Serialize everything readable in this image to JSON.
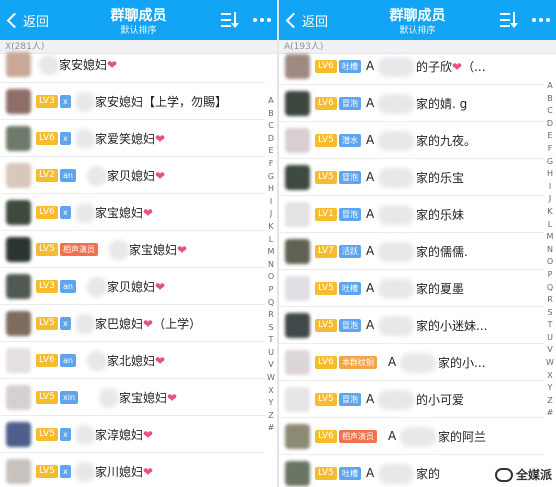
{
  "left": {
    "nav": {
      "back": "返回",
      "title": "群聊成员",
      "subtitle": "默认排序"
    },
    "section": "X(281人)",
    "rows": [
      {
        "lv": "",
        "tag": "",
        "tag_color": "blue",
        "pre": "",
        "name": "家安媳妇",
        "heart": "❤",
        "suffix": "",
        "avatar": "#c9a996"
      },
      {
        "lv": "LV3",
        "tag": "x",
        "tag_color": "blue",
        "pre": "",
        "name": "家安媳妇【上学，勿賜】",
        "heart": "",
        "suffix": "",
        "avatar": "#8d6f68"
      },
      {
        "lv": "LV6",
        "tag": "x",
        "tag_color": "blue",
        "pre": "",
        "name": "家爱笑媳妇",
        "heart": "❤",
        "suffix": "",
        "avatar": "#6f7a6b"
      },
      {
        "lv": "LV2",
        "tag": "an",
        "tag_color": "blue",
        "pre": "",
        "name": "家贝媳妇",
        "heart": "❤",
        "suffix": "",
        "avatar": "#d8c7bd"
      },
      {
        "lv": "LV6",
        "tag": "x",
        "tag_color": "blue",
        "pre": "",
        "name": "家宝媳妇",
        "heart": "❤",
        "suffix": "",
        "avatar": "#3f4a3e"
      },
      {
        "lv": "LV5",
        "tag": "相声演员",
        "tag_color": "red",
        "pre": "",
        "name": "家宝媳妇",
        "heart": "❤",
        "suffix": "",
        "avatar": "#2d3530"
      },
      {
        "lv": "LV3",
        "tag": "an",
        "tag_color": "blue",
        "pre": "",
        "name": "家贝媳妇",
        "heart": "❤",
        "suffix": "",
        "avatar": "#505a52"
      },
      {
        "lv": "LV5",
        "tag": "x",
        "tag_color": "blue",
        "pre": "",
        "name": "家巴媳妇",
        "heart": "❤",
        "suffix": "（上学）",
        "avatar": "#7f6c5f"
      },
      {
        "lv": "LV6",
        "tag": "an",
        "tag_color": "blue",
        "pre": "",
        "name": "家北媳妇",
        "heart": "❤",
        "suffix": "",
        "avatar": "#e5e1e1"
      },
      {
        "lv": "LV5",
        "tag": "xin",
        "tag_color": "blue",
        "pre": "",
        "name": "家宝媳妇",
        "heart": "❤",
        "suffix": "",
        "avatar": "#d5cfd3"
      },
      {
        "lv": "LV5",
        "tag": "x",
        "tag_color": "blue",
        "pre": "",
        "name": "家淳媳妇",
        "heart": "❤",
        "suffix": "",
        "avatar": "#4d5f8a"
      },
      {
        "lv": "LV5",
        "tag": "x",
        "tag_color": "blue",
        "pre": "",
        "name": "家川媳妇",
        "heart": "❤",
        "suffix": "",
        "avatar": "#c8c2be"
      }
    ]
  },
  "right": {
    "nav": {
      "back": "返回",
      "title": "群聊成员",
      "subtitle": "默认排序"
    },
    "section": "A(193人)",
    "rows": [
      {
        "lv": "LV6",
        "tag": "吐槽",
        "tag_color": "blue",
        "pre": "A",
        "name": "的子欣",
        "heart": "❤",
        "suffix": "（...",
        "avatar": "#9f8a83"
      },
      {
        "lv": "LV6",
        "tag": "冒泡",
        "tag_color": "blue",
        "pre": "A",
        "name": "家的婧. g",
        "heart": "",
        "suffix": "",
        "avatar": "#3e4640"
      },
      {
        "lv": "LV5",
        "tag": "潜水",
        "tag_color": "blue",
        "pre": "A",
        "name": "家的九夜。",
        "heart": "",
        "suffix": "",
        "avatar": "#d9ced3"
      },
      {
        "lv": "LV5",
        "tag": "冒泡",
        "tag_color": "blue",
        "pre": "A",
        "name": "家的乐宝",
        "heart": "",
        "suffix": "",
        "avatar": "#3d4a42"
      },
      {
        "lv": "LV1",
        "tag": "冒泡",
        "tag_color": "blue",
        "pre": "A",
        "name": "家的乐妹",
        "heart": "",
        "suffix": "",
        "avatar": "#e3e3e6"
      },
      {
        "lv": "LV7",
        "tag": "活跃",
        "tag_color": "blue",
        "pre": "A",
        "name": "家的儒儒.",
        "heart": "",
        "suffix": "",
        "avatar": "#5f6254"
      },
      {
        "lv": "LV5",
        "tag": "吐槽",
        "tag_color": "blue",
        "pre": "A",
        "name": "家的夏墨",
        "heart": "",
        "suffix": "",
        "avatar": "#e1dfe3"
      },
      {
        "lv": "LV5",
        "tag": "冒泡",
        "tag_color": "blue",
        "pre": "A",
        "name": "家的小迷妹...",
        "heart": "",
        "suffix": "",
        "avatar": "#40484a"
      },
      {
        "lv": "LV6",
        "tag": "本群纹铜",
        "tag_color": "orange",
        "pre": "A",
        "name": "家的小...",
        "heart": "",
        "suffix": "",
        "avatar": "#dcd6da"
      },
      {
        "lv": "LV5",
        "tag": "冒泡",
        "tag_color": "blue",
        "pre": "A",
        "name": "的小可爱",
        "heart": "",
        "suffix": "",
        "avatar": "#e8e5e8"
      },
      {
        "lv": "LV6",
        "tag": "相声演员",
        "tag_color": "red",
        "pre": "A",
        "name": "家的阿兰",
        "heart": "",
        "suffix": "",
        "avatar": "#8d8a73"
      },
      {
        "lv": "LV5",
        "tag": "吐槽",
        "tag_color": "blue",
        "pre": "A",
        "name": "家的",
        "heart": "",
        "suffix": "",
        "avatar": "#6a7565"
      }
    ]
  },
  "index_letters": [
    "A",
    "B",
    "C",
    "D",
    "E",
    "F",
    "G",
    "H",
    "I",
    "J",
    "K",
    "L",
    "M",
    "N",
    "O",
    "P",
    "Q",
    "R",
    "S",
    "T",
    "U",
    "V",
    "W",
    "X",
    "Y",
    "Z",
    "#"
  ],
  "watermark": "全媒派"
}
